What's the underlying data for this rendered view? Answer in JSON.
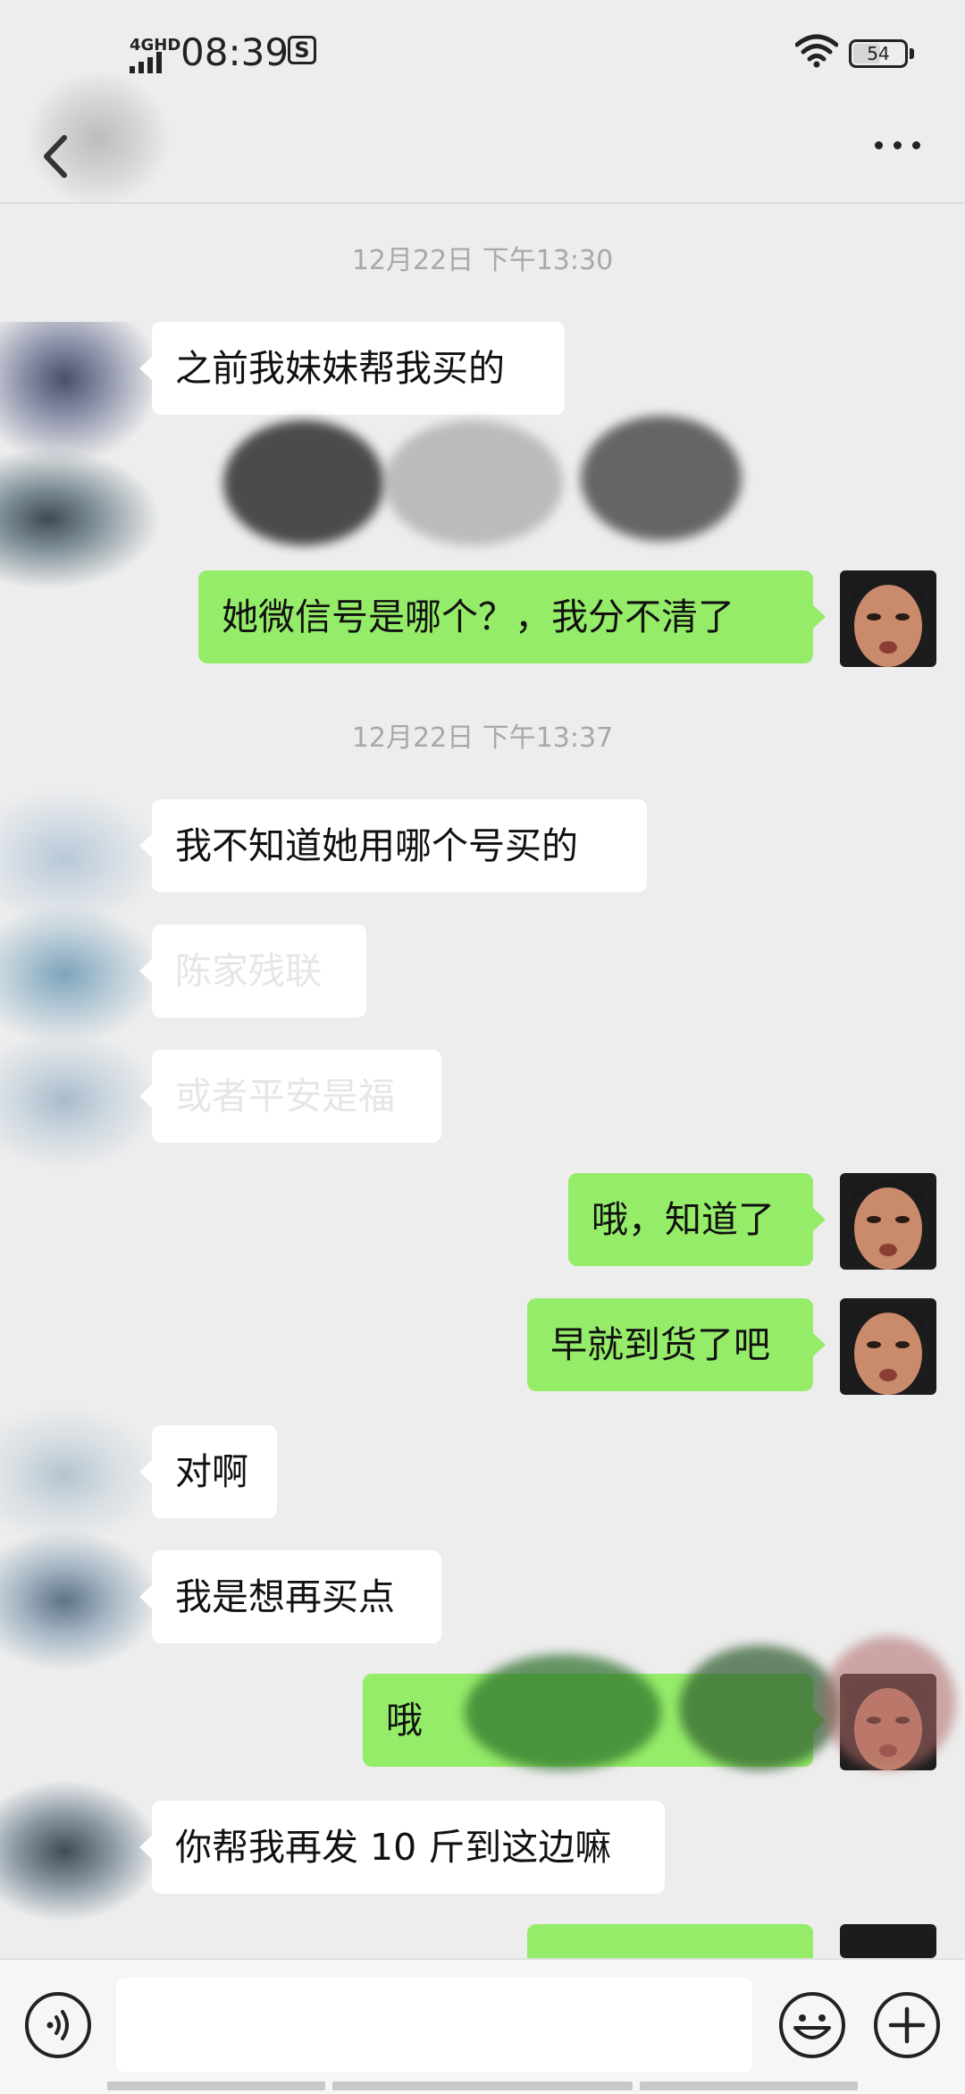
{
  "status_bar": {
    "network": "4GHD",
    "time": "08:39",
    "notification_badge": "S",
    "battery": "54",
    "battery_level": 0.54
  },
  "header": {
    "back_icon": "chevron-left-icon",
    "more_icon": "more-dots-icon"
  },
  "chat": {
    "timestamps": [
      "12月22日 下午13:30",
      "12月22日 下午13:37"
    ],
    "messages": [
      {
        "side": "in",
        "text": "之前我妹妹帮我买的"
      },
      {
        "side": "out",
        "text": "她微信号是哪个？，我分不清了"
      },
      {
        "side": "in",
        "text": "我不知道她用哪个号买的"
      },
      {
        "side": "in",
        "text": "陈家残联"
      },
      {
        "side": "in",
        "text": "或者平安是福"
      },
      {
        "side": "out",
        "text": "哦，知道了"
      },
      {
        "side": "out",
        "text": "早就到货了吧"
      },
      {
        "side": "in",
        "text": "对啊"
      },
      {
        "side": "in",
        "text": "我是想再买点"
      },
      {
        "side": "out",
        "text": "哦"
      },
      {
        "side": "in",
        "text": "你帮我再发 10 斤到这边嘛"
      }
    ]
  },
  "input_bar": {
    "voice_icon": "voice-icon",
    "emoji_icon": "emoji-icon",
    "plus_icon": "plus-icon",
    "placeholder": ""
  },
  "colors": {
    "background": "#ededed",
    "incoming_bubble": "#ffffff",
    "outgoing_bubble": "#95ec69",
    "timestamp_text": "#a8a8a8"
  }
}
